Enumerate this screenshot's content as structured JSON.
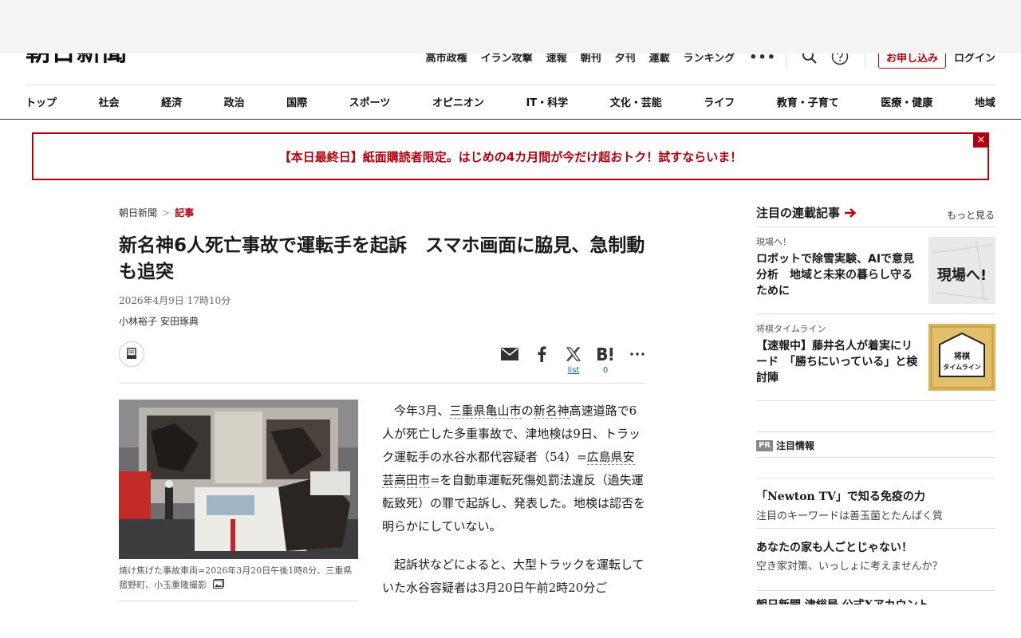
{
  "header": {
    "logo": "朝日新聞",
    "util_nav": [
      "高市政権",
      "イラン攻撃",
      "速報",
      "朝刊",
      "夕刊",
      "連載",
      "ランキング"
    ],
    "more_label": "•••",
    "signup_label": "お申し込み",
    "login_label": "ログイン"
  },
  "categories": [
    "トップ",
    "社会",
    "経済",
    "政治",
    "国際",
    "スポーツ",
    "オピニオン",
    "IT・科学",
    "文化・芸能",
    "ライフ",
    "教育・子育て",
    "医療・健康",
    "地域"
  ],
  "promo": {
    "text": "【本日最終日】紙面購読者限定。はじめの4カ月間が今だけ超おトク！試すならいま！",
    "close": "×"
  },
  "article": {
    "breadcrumb": {
      "home": "朝日新聞",
      "sep": ">",
      "current": "記事"
    },
    "title": "新名神6人死亡事故で運転手を起訴　スマホ画面に脇見、急制動も追突",
    "date": "2026年4月9日 17時10分",
    "authors": "小林裕子 安田琢典",
    "share": {
      "x_count": "list",
      "hatena_count": "0"
    },
    "caption": "焼け焦げた事故車両=2026年3月20日午後1時8分、三重県菰野町、小玉重隆撮影",
    "p1": {
      "a": "今年3月、",
      "l1": "三重県亀山市",
      "b": "の",
      "l2": "新名神",
      "c": "高速道路で6人が死亡した多重事故で、津地検は9日、トラック運転手の水谷水都代容疑者（54）=",
      "l3": "広島県安芸高田市",
      "d": "=を自動車運転死傷処罰法違反（過失運転致死）の罪で起訴し、発表した。地検は認否を明らかにしていない。"
    },
    "p2": "起訴状などによると、大型トラックを運転していた水谷容疑者は3月20日午前2時20分ご"
  },
  "sidebar": {
    "title": "注目の連載記事",
    "more": "もっと見る",
    "items": [
      {
        "label": "現場へ！",
        "title": "ロボットで除雪実験、AIで意見分析　地域と未来の暮らし守るために",
        "thumb_text": "現場へ!"
      },
      {
        "label": "将棋タイムライン",
        "title": "【速報中】藤井名人が着実にリード　「勝ちにいっている」と検討陣",
        "thumb_text1": "将棋",
        "thumb_text2": "タイムライン"
      }
    ],
    "pr_badge": "PR",
    "pr_title": "注目情報",
    "pr_items": [
      {
        "title": "「Newton TV」で知る免疫の力",
        "sub": "注目のキーワードは善玉菌とたんぱく質"
      },
      {
        "title": "あなたの家も人ごとじゃない！",
        "sub": "空き家対策、いっしょに考えませんか？"
      },
      {
        "title": "朝日新聞 津総局 公式Xアカウント"
      }
    ]
  },
  "colors": {
    "accent": "#b1000e",
    "link": "#0b64a8"
  }
}
